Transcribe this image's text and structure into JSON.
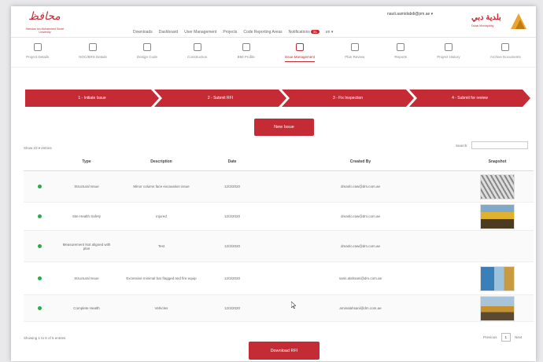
{
  "header": {
    "logo_left_script": "محافظ",
    "logo_left_tagline": "Hamdan bin Mohammed Smart University",
    "user_email": "nauti.aamidabdi@pm.ae ▾",
    "nav_links": [
      "Downloads",
      "Dashboard",
      "User Management",
      "Projects",
      "Code Reporting Areas",
      "Notifications",
      "en ▾"
    ],
    "notifications_count": "31",
    "logo_right_text": "بلدية دبي",
    "logo_right_sub": "Dubai Municipality"
  },
  "modules": [
    {
      "label": "Project Details",
      "icon": "document-icon",
      "active": false
    },
    {
      "label": "NOC/BRS Details",
      "icon": "people-icon",
      "active": false
    },
    {
      "label": "Design Code",
      "icon": "tools-icon",
      "active": false
    },
    {
      "label": "Construction",
      "icon": "building-icon",
      "active": false
    },
    {
      "label": "BMI Profile",
      "icon": "globe-icon",
      "active": false
    },
    {
      "label": "Issue Management",
      "icon": "clipboard-icon",
      "active": true
    },
    {
      "label": "Plan Review",
      "icon": "calendar-icon",
      "active": false
    },
    {
      "label": "Reports",
      "icon": "trash-icon",
      "active": false
    },
    {
      "label": "Project History",
      "icon": "history-icon",
      "active": false
    },
    {
      "label": "Archive Documents",
      "icon": "grid-icon",
      "active": false
    }
  ],
  "stepper": [
    "1 - Initiate Issue",
    "2 - Submit RFI",
    "3 - Fix Inspection",
    "4 - Submit for review"
  ],
  "new_issue_label": "New Issue",
  "show_entries": "Show 10 ▾ entries",
  "search_label": "Search:",
  "table": {
    "headers": [
      "",
      "Type",
      "Description",
      "Date",
      "Created By",
      "Snapshot"
    ],
    "rows": [
      {
        "type": "Structural Issue",
        "description": "Minor column face excavation issue",
        "date": "12/3/2020",
        "created_by": "dmanlo.raw@dm.com.ae",
        "has_image": true,
        "thumb": "scaffold"
      },
      {
        "type": "Site Health Safety",
        "description": "Injured",
        "date": "12/3/2020",
        "created_by": "dmanlo.raw@dm.com.ae",
        "has_image": true,
        "thumb": "yellow"
      },
      {
        "type": "Measurement Not aligned with plan",
        "description": "Test",
        "date": "12/3/2020",
        "created_by": "dmanlo.raw@dm.com.ae",
        "has_image": false,
        "thumb": ""
      },
      {
        "type": "Structural Issue",
        "description": "Excessive minimal bar flagged and fire equip",
        "date": "12/3/2020",
        "created_by": "sami.alahsani@dm.com.ae",
        "has_image": true,
        "thumb": "blue"
      },
      {
        "type": "Complete Health",
        "description": "Vehicles",
        "date": "12/3/2020",
        "created_by": "aminalahsani@dm.com.ae",
        "has_image": true,
        "thumb": "site"
      }
    ]
  },
  "footer_info": "Showing 1 to 5 of 5 entries",
  "pager": {
    "prev": "Previous",
    "page": "1",
    "next": "Next"
  },
  "download_label": "Download RFI"
}
